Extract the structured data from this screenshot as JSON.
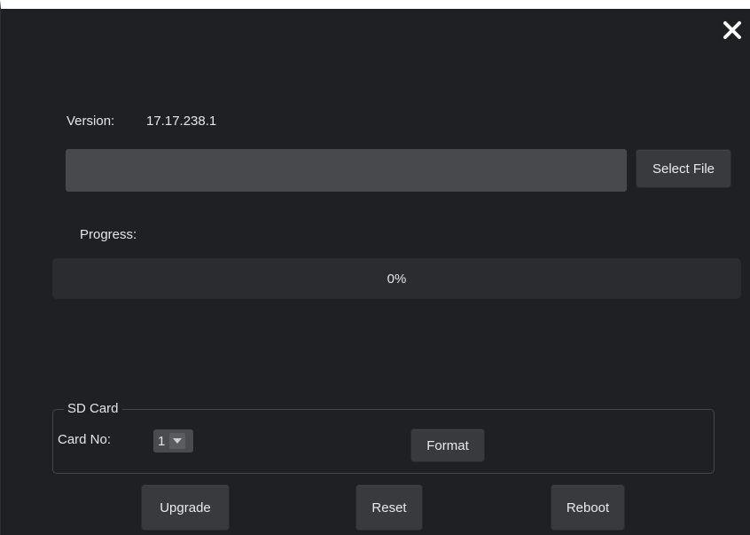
{
  "dialog": {
    "close_icon": "close-icon",
    "version": {
      "label": "Version:",
      "value": "17.17.238.1"
    },
    "file": {
      "path_value": "",
      "select_button_label": "Select File"
    },
    "progress": {
      "label": "Progress:",
      "percent": 0,
      "text": "0%",
      "fill_color": "#3c7dd9"
    },
    "sd_card": {
      "title": "SD Card",
      "card_no_label": "Card No:",
      "card_no_value": "1",
      "format_button_label": "Format"
    },
    "actions": {
      "upgrade_label": "Upgrade",
      "reset_label": "Reset",
      "reboot_label": "Reboot"
    }
  }
}
